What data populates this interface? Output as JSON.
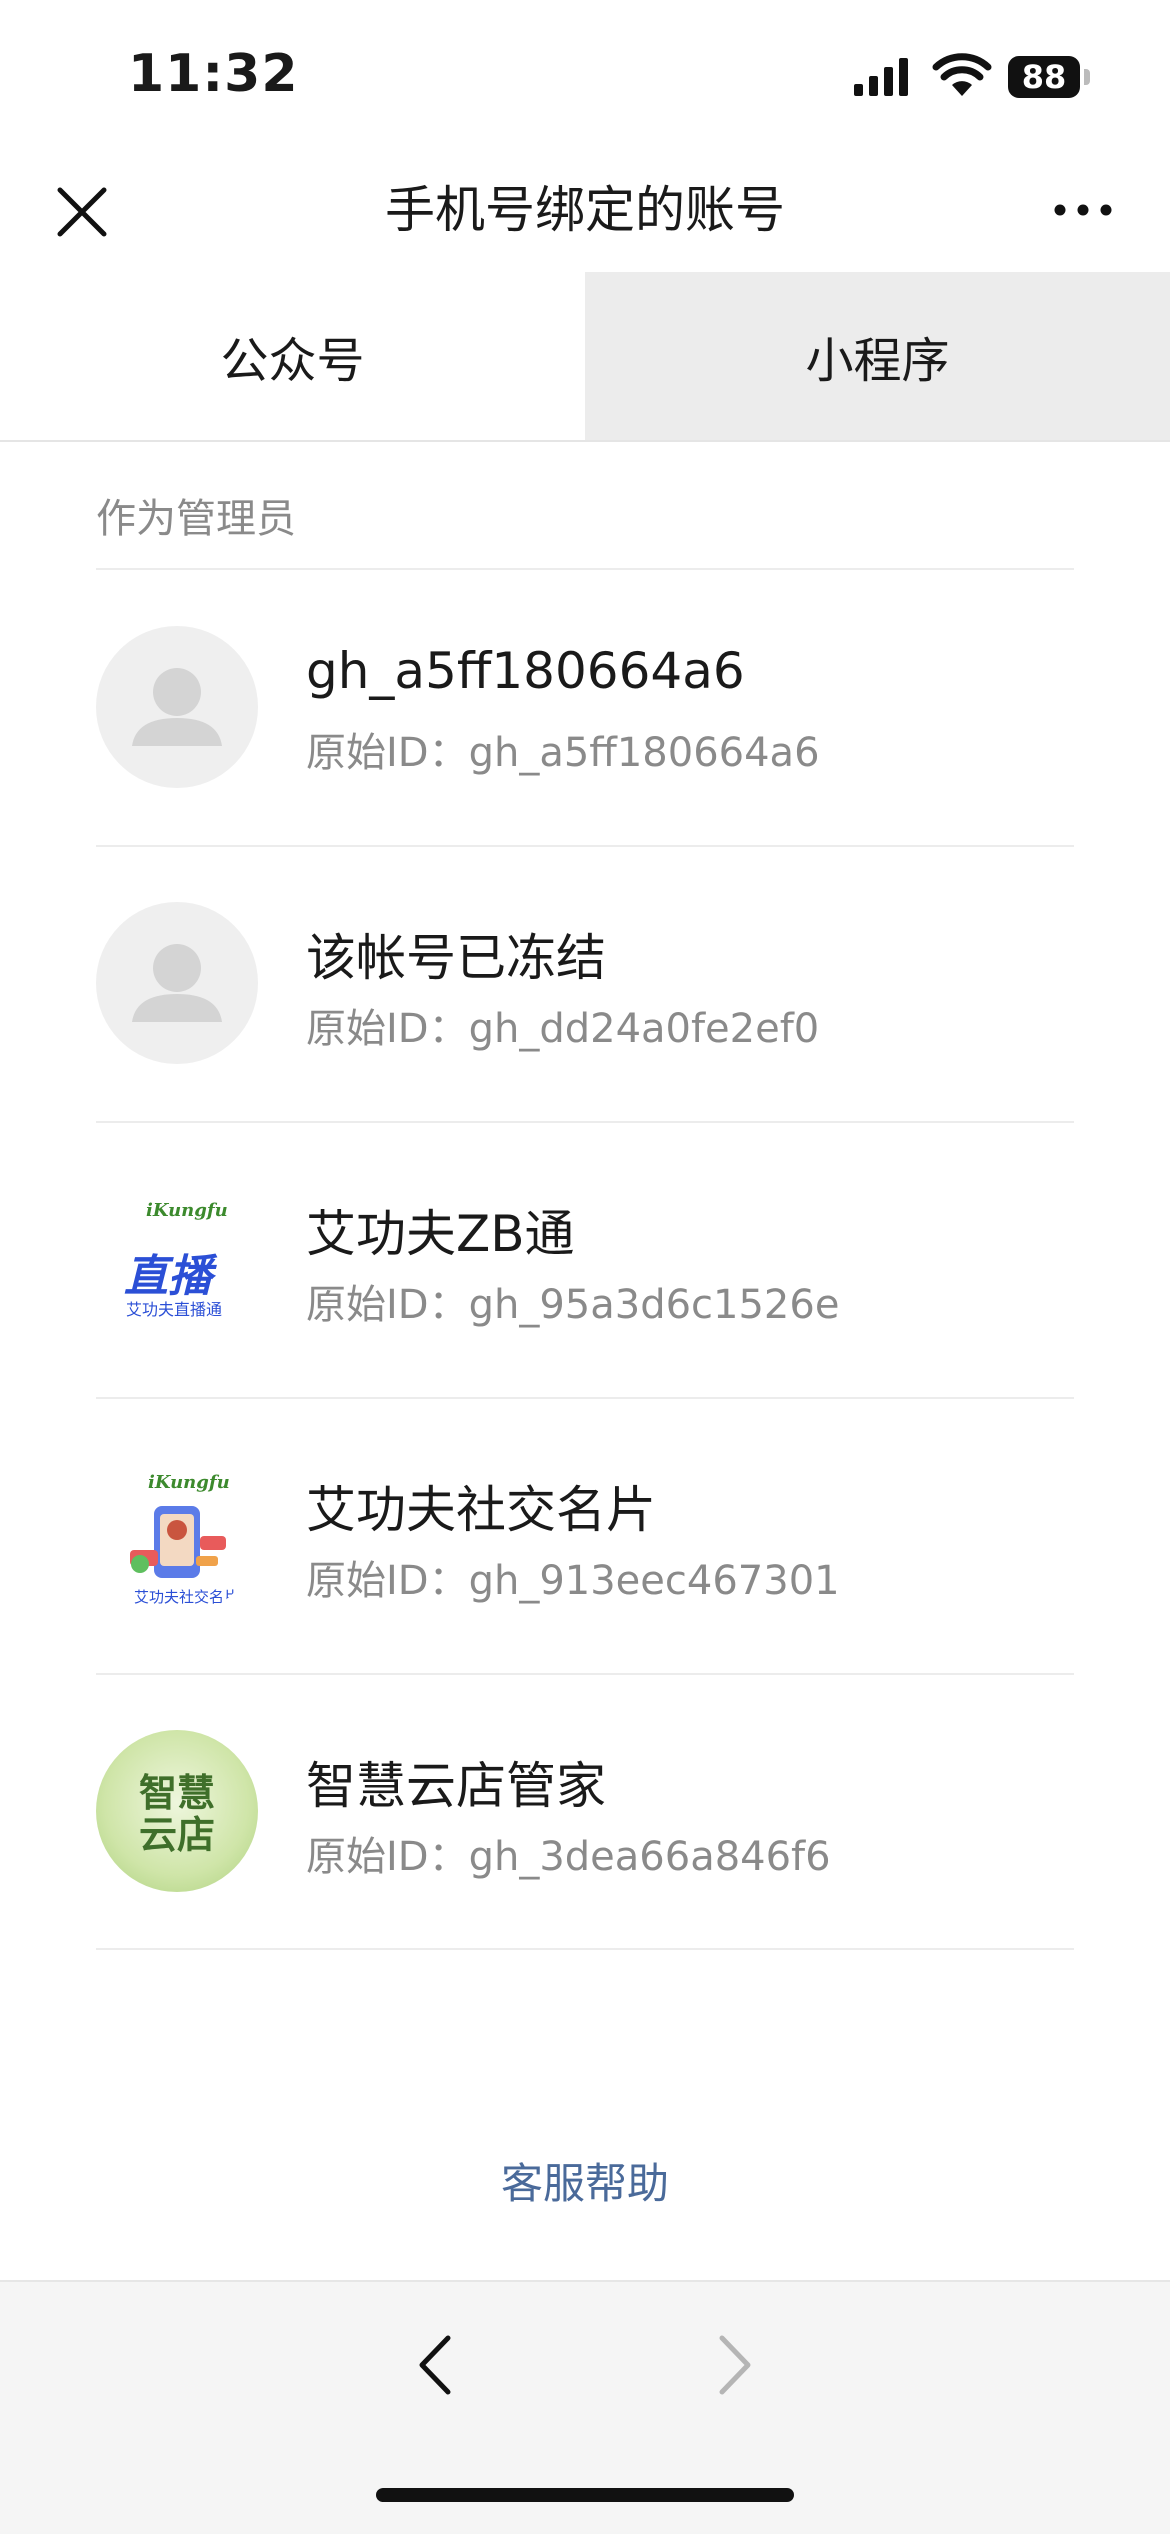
{
  "status_bar": {
    "time": "11:32",
    "battery": "88"
  },
  "nav": {
    "title": "手机号绑定的账号"
  },
  "tabs": [
    {
      "label": "公众号",
      "selected": true
    },
    {
      "label": "小程序",
      "selected": false
    }
  ],
  "section": {
    "header": "作为管理员"
  },
  "accounts": [
    {
      "name": "gh_a5ff180664a6",
      "id_line": "原始ID：gh_a5ff180664a6",
      "avatar": "default-avatar-icon"
    },
    {
      "name": "该帐号已冻结",
      "id_line": "原始ID：gh_dd24a0fe2ef0",
      "avatar": "default-avatar-icon"
    },
    {
      "name": "艾功夫ZB通",
      "id_line": "原始ID：gh_95a3d6c1526e",
      "avatar": "zb-logo",
      "logo_brand": "iKungfu",
      "logo_main": "直播",
      "logo_sub": "艾功夫直播通"
    },
    {
      "name": "艾功夫社交名片",
      "id_line": "原始ID：gh_913eec467301",
      "avatar": "social-card-logo",
      "logo_brand": "iKungfu",
      "logo_sub": "艾功夫社交名片"
    },
    {
      "name": "智慧云店管家",
      "id_line": "原始ID：gh_3dea66a846f6",
      "avatar": "smart-store-logo",
      "logo_main": "智慧云店"
    }
  ],
  "footer": {
    "help": "客服帮助"
  },
  "colors": {
    "tab_unselected_bg": "#ececec",
    "link": "#4a6a9a",
    "secondary_text": "#8a8a8a"
  }
}
